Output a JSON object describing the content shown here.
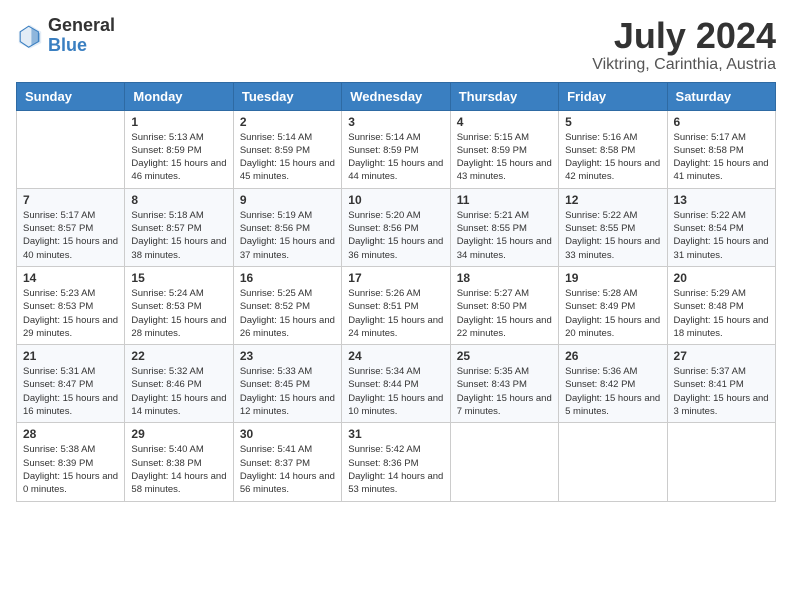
{
  "header": {
    "logo_general": "General",
    "logo_blue": "Blue",
    "month": "July 2024",
    "location": "Viktring, Carinthia, Austria"
  },
  "weekdays": [
    "Sunday",
    "Monday",
    "Tuesday",
    "Wednesday",
    "Thursday",
    "Friday",
    "Saturday"
  ],
  "weeks": [
    [
      null,
      {
        "day": "1",
        "sunrise": "Sunrise: 5:13 AM",
        "sunset": "Sunset: 8:59 PM",
        "daylight": "Daylight: 15 hours and 46 minutes."
      },
      {
        "day": "2",
        "sunrise": "Sunrise: 5:14 AM",
        "sunset": "Sunset: 8:59 PM",
        "daylight": "Daylight: 15 hours and 45 minutes."
      },
      {
        "day": "3",
        "sunrise": "Sunrise: 5:14 AM",
        "sunset": "Sunset: 8:59 PM",
        "daylight": "Daylight: 15 hours and 44 minutes."
      },
      {
        "day": "4",
        "sunrise": "Sunrise: 5:15 AM",
        "sunset": "Sunset: 8:59 PM",
        "daylight": "Daylight: 15 hours and 43 minutes."
      },
      {
        "day": "5",
        "sunrise": "Sunrise: 5:16 AM",
        "sunset": "Sunset: 8:58 PM",
        "daylight": "Daylight: 15 hours and 42 minutes."
      },
      {
        "day": "6",
        "sunrise": "Sunrise: 5:17 AM",
        "sunset": "Sunset: 8:58 PM",
        "daylight": "Daylight: 15 hours and 41 minutes."
      }
    ],
    [
      {
        "day": "7",
        "sunrise": "Sunrise: 5:17 AM",
        "sunset": "Sunset: 8:57 PM",
        "daylight": "Daylight: 15 hours and 40 minutes."
      },
      {
        "day": "8",
        "sunrise": "Sunrise: 5:18 AM",
        "sunset": "Sunset: 8:57 PM",
        "daylight": "Daylight: 15 hours and 38 minutes."
      },
      {
        "day": "9",
        "sunrise": "Sunrise: 5:19 AM",
        "sunset": "Sunset: 8:56 PM",
        "daylight": "Daylight: 15 hours and 37 minutes."
      },
      {
        "day": "10",
        "sunrise": "Sunrise: 5:20 AM",
        "sunset": "Sunset: 8:56 PM",
        "daylight": "Daylight: 15 hours and 36 minutes."
      },
      {
        "day": "11",
        "sunrise": "Sunrise: 5:21 AM",
        "sunset": "Sunset: 8:55 PM",
        "daylight": "Daylight: 15 hours and 34 minutes."
      },
      {
        "day": "12",
        "sunrise": "Sunrise: 5:22 AM",
        "sunset": "Sunset: 8:55 PM",
        "daylight": "Daylight: 15 hours and 33 minutes."
      },
      {
        "day": "13",
        "sunrise": "Sunrise: 5:22 AM",
        "sunset": "Sunset: 8:54 PM",
        "daylight": "Daylight: 15 hours and 31 minutes."
      }
    ],
    [
      {
        "day": "14",
        "sunrise": "Sunrise: 5:23 AM",
        "sunset": "Sunset: 8:53 PM",
        "daylight": "Daylight: 15 hours and 29 minutes."
      },
      {
        "day": "15",
        "sunrise": "Sunrise: 5:24 AM",
        "sunset": "Sunset: 8:53 PM",
        "daylight": "Daylight: 15 hours and 28 minutes."
      },
      {
        "day": "16",
        "sunrise": "Sunrise: 5:25 AM",
        "sunset": "Sunset: 8:52 PM",
        "daylight": "Daylight: 15 hours and 26 minutes."
      },
      {
        "day": "17",
        "sunrise": "Sunrise: 5:26 AM",
        "sunset": "Sunset: 8:51 PM",
        "daylight": "Daylight: 15 hours and 24 minutes."
      },
      {
        "day": "18",
        "sunrise": "Sunrise: 5:27 AM",
        "sunset": "Sunset: 8:50 PM",
        "daylight": "Daylight: 15 hours and 22 minutes."
      },
      {
        "day": "19",
        "sunrise": "Sunrise: 5:28 AM",
        "sunset": "Sunset: 8:49 PM",
        "daylight": "Daylight: 15 hours and 20 minutes."
      },
      {
        "day": "20",
        "sunrise": "Sunrise: 5:29 AM",
        "sunset": "Sunset: 8:48 PM",
        "daylight": "Daylight: 15 hours and 18 minutes."
      }
    ],
    [
      {
        "day": "21",
        "sunrise": "Sunrise: 5:31 AM",
        "sunset": "Sunset: 8:47 PM",
        "daylight": "Daylight: 15 hours and 16 minutes."
      },
      {
        "day": "22",
        "sunrise": "Sunrise: 5:32 AM",
        "sunset": "Sunset: 8:46 PM",
        "daylight": "Daylight: 15 hours and 14 minutes."
      },
      {
        "day": "23",
        "sunrise": "Sunrise: 5:33 AM",
        "sunset": "Sunset: 8:45 PM",
        "daylight": "Daylight: 15 hours and 12 minutes."
      },
      {
        "day": "24",
        "sunrise": "Sunrise: 5:34 AM",
        "sunset": "Sunset: 8:44 PM",
        "daylight": "Daylight: 15 hours and 10 minutes."
      },
      {
        "day": "25",
        "sunrise": "Sunrise: 5:35 AM",
        "sunset": "Sunset: 8:43 PM",
        "daylight": "Daylight: 15 hours and 7 minutes."
      },
      {
        "day": "26",
        "sunrise": "Sunrise: 5:36 AM",
        "sunset": "Sunset: 8:42 PM",
        "daylight": "Daylight: 15 hours and 5 minutes."
      },
      {
        "day": "27",
        "sunrise": "Sunrise: 5:37 AM",
        "sunset": "Sunset: 8:41 PM",
        "daylight": "Daylight: 15 hours and 3 minutes."
      }
    ],
    [
      {
        "day": "28",
        "sunrise": "Sunrise: 5:38 AM",
        "sunset": "Sunset: 8:39 PM",
        "daylight": "Daylight: 15 hours and 0 minutes."
      },
      {
        "day": "29",
        "sunrise": "Sunrise: 5:40 AM",
        "sunset": "Sunset: 8:38 PM",
        "daylight": "Daylight: 14 hours and 58 minutes."
      },
      {
        "day": "30",
        "sunrise": "Sunrise: 5:41 AM",
        "sunset": "Sunset: 8:37 PM",
        "daylight": "Daylight: 14 hours and 56 minutes."
      },
      {
        "day": "31",
        "sunrise": "Sunrise: 5:42 AM",
        "sunset": "Sunset: 8:36 PM",
        "daylight": "Daylight: 14 hours and 53 minutes."
      },
      null,
      null,
      null
    ]
  ]
}
